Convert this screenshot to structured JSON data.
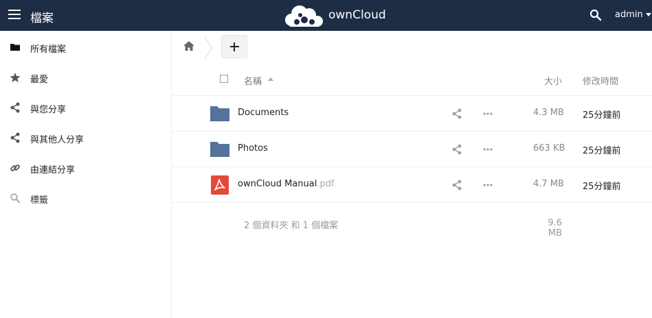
{
  "header": {
    "app_title": "檔案",
    "brand": "ownCloud",
    "user": "admin",
    "background": "#1d2d44"
  },
  "sidebar": {
    "items": [
      {
        "label": "所有檔案",
        "icon": "folder-icon"
      },
      {
        "label": "最愛",
        "icon": "star-icon"
      },
      {
        "label": "與您分享",
        "icon": "share-icon"
      },
      {
        "label": "與其他人分享",
        "icon": "share-icon"
      },
      {
        "label": "由連結分享",
        "icon": "link-icon"
      },
      {
        "label": "標籤",
        "icon": "search-icon"
      }
    ]
  },
  "table": {
    "col_name": "名稱",
    "col_size": "大小",
    "col_modified": "修改時間",
    "rows": [
      {
        "name": "Documents",
        "ext": "",
        "type": "folder",
        "size": "4.3 MB",
        "modified": "25分鐘前"
      },
      {
        "name": "Photos",
        "ext": "",
        "type": "folder",
        "size": "663 KB",
        "modified": "25分鐘前"
      },
      {
        "name": "ownCloud Manual",
        "ext": ".pdf",
        "type": "pdf",
        "size": "4.7 MB",
        "modified": "25分鐘前"
      }
    ],
    "summary_info": "2 個資料夾 和 1 個檔案",
    "summary_total": "9.6 MB"
  },
  "colors": {
    "folder": "#55739a",
    "pdf": "#e44a3c",
    "icon_gray": "#9e9e9e"
  }
}
